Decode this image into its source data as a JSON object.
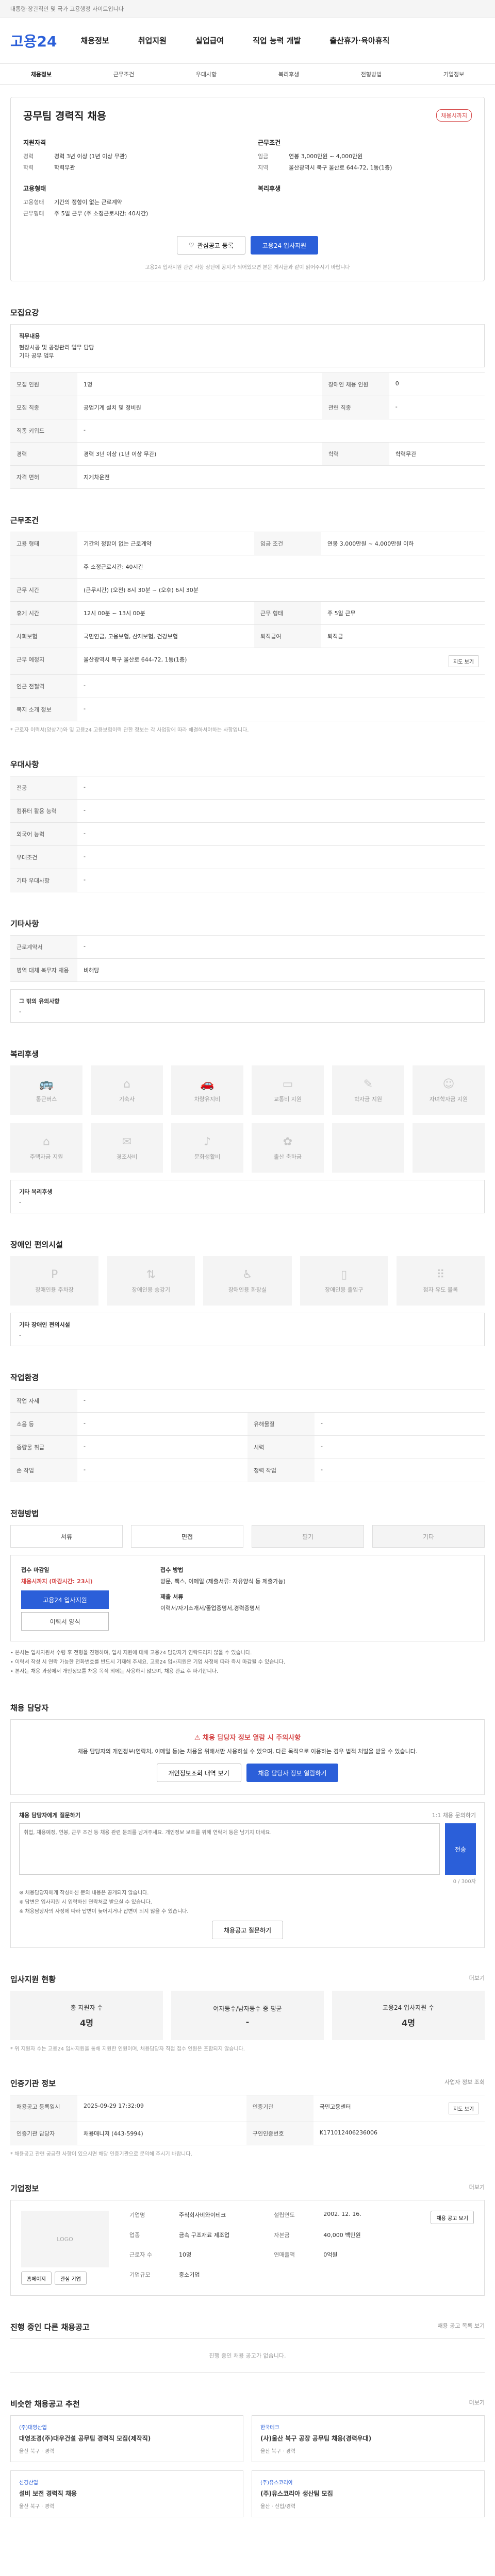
{
  "topbar": {
    "text": "대통령·장관직인 및 국가 고용행정 사이트입니다"
  },
  "header": {
    "logo": "고용24",
    "nav": [
      "채용정보",
      "취업지원",
      "실업급여",
      "직업 능력 개발",
      "출산휴가·육아휴직"
    ]
  },
  "subnav": [
    "채용정보",
    "근무조건",
    "우대사항",
    "복리후생",
    "전형방법",
    "기업정보"
  ],
  "job": {
    "title": "공무팀 경력직 채용",
    "badge": "채용시까지",
    "company": "",
    "left_head": "지원자격",
    "left_rows": [
      {
        "k": "경력",
        "v": "경력 3년 이상 (1년 이상 무관)"
      },
      {
        "k": "학력",
        "v": "학력무관"
      }
    ],
    "left_head2": "고용형태",
    "left_rows2": [
      {
        "k": "고용형태",
        "v": "기간의 정함이 없는 근로계약"
      },
      {
        "k": "근무형태",
        "v": "주 5일 근무 (주 소정근로시간: 40시간)"
      }
    ],
    "right_head": "근무조건",
    "right_rows": [
      {
        "k": "임금",
        "v": "연봉 3,000만원 ~ 4,000만원"
      },
      {
        "k": "지역",
        "v": "울산광역시 북구 울산로 644-72, 1동(1층)"
      }
    ],
    "right_head2": "복리후생",
    "btn_save": "관심공고 등록",
    "btn_apply": "고용24 입사지원",
    "note": "고용24 입사지원 관련 사항 상단에 공지가 되어있으면 본문 게시글과 같이 읽어주시기 바랍니다"
  },
  "recruit": {
    "title": "모집요강",
    "duty_label": "직무내용",
    "duty_lines": [
      "현장시공 및 공정관리 업무 담당",
      "기타 공무 업무"
    ],
    "rows": [
      {
        "k": "모집 인원",
        "v": "1명",
        "k2": "장애인 채용 인원",
        "v2": "0"
      },
      {
        "k": "모집 직종",
        "v": "공업기계 설치 및 정비원",
        "k2": "관련 직종",
        "v2": "-"
      },
      {
        "k": "직종 키워드",
        "v": "-",
        "k2": "",
        "v2": ""
      },
      {
        "k": "경력",
        "v": "경력 3년 이상 (1년 이상 무관)",
        "k2": "학력",
        "v2": "학력무관"
      },
      {
        "k": "자격 면허",
        "v": "지게차운전",
        "k2": "",
        "v2": ""
      }
    ]
  },
  "conditions": {
    "title": "근무조건",
    "rows": [
      {
        "k": "고용 형태",
        "v": "기간의 정함이 없는 근로계약",
        "k2": "임금 조건",
        "v2": "연봉 3,000만원 ~ 4,000만원 이하"
      },
      {
        "k": "",
        "v": "주 소정근로시간: 40시간",
        "k2": "",
        "v2": ""
      },
      {
        "k": "근무 시간",
        "v": "(근무시간) (오전) 8시 30분 ~ (오후) 6시 30분",
        "k2": "",
        "v2": ""
      },
      {
        "k": "휴게 시간",
        "v": "12시 00분 ~ 13시 00분",
        "k2": "근무 형태",
        "v2": "주 5일 근무"
      },
      {
        "k": "사회보험",
        "v": "국민연금, 고용보험, 산재보험, 건강보험",
        "k2": "퇴직급여",
        "v2": "퇴직금"
      },
      {
        "k": "근무 예정지",
        "v": "울산광역시 북구 울산로 644-72, 1동(1층)",
        "k2": "",
        "v2": ""
      },
      {
        "k": "인근 전철역",
        "v": "-",
        "k2": "",
        "v2": ""
      },
      {
        "k": "복지 소개 정보",
        "v": "-",
        "k2": "",
        "v2": ""
      }
    ],
    "map_btn": "지도 보기",
    "footnote": "* 근로자 이력서(앙상기)와 및 고용24 고용보험이력 관한 정보는 각 사업장에 따라 해결하셔야하는 사항입니다."
  },
  "pref": {
    "title": "우대사항",
    "rows": [
      {
        "k": "전공",
        "v": "-"
      },
      {
        "k": "컴퓨터 활용 능력",
        "v": "-"
      },
      {
        "k": "외국어 능력",
        "v": "-"
      },
      {
        "k": "우대조건",
        "v": "-"
      },
      {
        "k": "기타 우대사항",
        "v": "-"
      }
    ]
  },
  "etc": {
    "title": "기타사항",
    "rows": [
      {
        "k": "근로계약서",
        "v": "-"
      },
      {
        "k": "병역 대체 복무자 채용",
        "v": "비해당"
      }
    ],
    "box_label": "그 밖의 유의사항",
    "box_value": "-"
  },
  "welfare": {
    "title": "복리후생",
    "items": [
      "통근버스",
      "기숙사",
      "차량유지비",
      "교통비 지원",
      "학자금 지원",
      "자녀학자금 지원",
      "주택자금 지원",
      "경조사비",
      "문화생활비",
      "출산 축하금",
      "",
      ""
    ],
    "etc_label": "기타 복리후생",
    "etc_value": "-"
  },
  "disability": {
    "title": "장애인 편의시설",
    "items": [
      "장애인용 주차장",
      "장애인용 승강기",
      "장애인용 화장실",
      "장애인용 출입구",
      "점자 유도 블록"
    ],
    "etc_label": "기타 장애인 편의시설",
    "etc_value": "-"
  },
  "workplace": {
    "title": "작업환경",
    "rows": [
      {
        "k": "작업 자세",
        "v": "-",
        "k2": "",
        "v2": ""
      },
      {
        "k": "소음 등",
        "v": "-",
        "k2": "유해물질",
        "v2": "-"
      },
      {
        "k": "중량물 취급",
        "v": "-",
        "k2": "시력",
        "v2": "-"
      },
      {
        "k": "손 작업",
        "v": "-",
        "k2": "청력 작업",
        "v2": "-"
      }
    ]
  },
  "selection": {
    "title": "전형방법",
    "methods": [
      "서류",
      "면접",
      "필기",
      "기타"
    ],
    "period_label": "접수 마감일",
    "period_value": "채용시까지 (마감시간: 23시)",
    "btn_apply": "고용24 입사지원",
    "btn_form": "이력서 양식",
    "method_label": "접수 방법",
    "method_value": "방문, 팩스, 이메일 (제출서류: 자유양식 등 제출가능)",
    "doc_label": "제출 서류",
    "doc_value": "이력서/자기소개서/졸업증명서,경력증명서",
    "bullets": [
      "• 본사는 입사지원서 수령 후 전형을 진행하며, 입사 지원에 대해 고용24 담당자가 연락드리지 않을 수 있습니다.",
      "• 이력서 작성 시 연락 가능한 전화번호를 반드시 기재해 주세요. 고용24 입사지원은 기업 사정에 따라 즉시 마감될 수 있습니다.",
      "• 본사는 채용 과정에서 개인정보를 채용 목적 외에는 사용하지 않으며, 채용 완료 후 파기합니다."
    ]
  },
  "contact": {
    "title": "채용 담당자",
    "alert_title": "채용 담당자 정보 열람 시 주의사항",
    "alert_text": "채용 담당자의 개인정보(연락처, 이메일 등)는 채용을 위해서만 사용하실 수 있으며, 다른 목적으로 이용하는 경우 법적 처벌을 받을 수 있습니다.",
    "btn_history": "개인정보조회 내역 보기",
    "btn_view": "채용 담당자 정보 열람하기",
    "qa_title": "채용 담당자에게 질문하기",
    "qa_hint": "1:1 채용 문의하기",
    "qa_placeholder": "취업, 채용예정, 연봉, 근무 조건 등 채용 관련 문의를 남겨주세요. 개인정보 보호를 위해 연락처 등은 남기지 마세요.",
    "qa_count": "0 / 300자",
    "qa_send": "전송",
    "qa_notes": [
      "※ 채용담당자에게 작성하신 문의 내용은 공개되지 않습니다.",
      "※ 답변은 입사지원 시 입력하신 연락처로 받으실 수 있습니다.",
      "※ 채용담당자의 사정에 따라 답변이 늦어지거나 답변이 되지 않을 수 있습니다."
    ],
    "btn_more": "채용공고 질문하기"
  },
  "applicants": {
    "title": "입사지원 현황",
    "more": "더보기",
    "stats": [
      {
        "label": "총 지원자 수",
        "value": "4명"
      },
      {
        "label": "여자등수/남자등수 중 평균",
        "value": "-"
      },
      {
        "label": "고용24 입사지원 수",
        "value": "4명"
      }
    ],
    "note": "* 위 지원자 수는 고용24 입사지원을 통해 지원한 인원이며, 채용담당자 직접 접수 인원은 포함되지 않습니다."
  },
  "organization": {
    "title": "인증기관 정보",
    "more": "사업자 정보 조회",
    "rows": [
      {
        "k": "채용공고 등록일시",
        "v": "2025-09-29 17:32:09",
        "k2": "인증기관",
        "v2": "국민고용센터",
        "btn": "지도 보기"
      },
      {
        "k": "인증기관 담당자",
        "v": "채용매니저 (443-5994)",
        "k2": "구인인증번호",
        "v2": "K171012406236006"
      }
    ],
    "note": "* 채용공고 관련 궁금한 사항이 있으시면 해당 인증기관으로 문의해 주시기 바랍니다."
  },
  "company_info": {
    "title": "기업정보",
    "logo": "LOGO",
    "more": "더보기",
    "rows": [
      {
        "k": "기업명",
        "v": "주식회사비와이테크",
        "k2": "설립연도",
        "v2": "2002. 12. 16."
      },
      {
        "k": "업종",
        "v": "금속 구조재료 제조업",
        "k2": "자본금",
        "v2": "40,000 백만원"
      },
      {
        "k": "근로자 수",
        "v": "10명",
        "k2": "연매출액",
        "v2": "0억원"
      },
      {
        "k": "기업규모",
        "v": "중소기업",
        "k2": "",
        "v2": ""
      }
    ],
    "btn_homepage": "홈페이지",
    "btn_jobs": "채용 공고 보기",
    "btn_follow": "관심 기업"
  },
  "other_jobs": {
    "title": "진행 중인 다른 채용공고",
    "more": "채용 공고 목록 보기",
    "empty": "진행 중인 채용 공고가 없습니다."
  },
  "recommend": {
    "title": "비슷한 채용공고 추천",
    "more": "더보기",
    "items": [
      {
        "co": "(주)대영산업",
        "tt": "대영조경(주)대우건설 공무팀 경력직 모집(제작직)",
        "meta": "울산 북구 · 경력"
      },
      {
        "co": "한국테크",
        "tt": "(사)울산 북구 공장 공무팀 채용(경력우대)",
        "meta": "울산 북구 · 경력"
      },
      {
        "co": "신경산업",
        "tt": "설비 보전 경력직 채용",
        "meta": "울산 북구 · 경력"
      },
      {
        "co": "(주)유스코리아",
        "tt": "(주)유스코리아 생산팀 모집",
        "meta": "울산 · 신입/경력"
      }
    ]
  }
}
